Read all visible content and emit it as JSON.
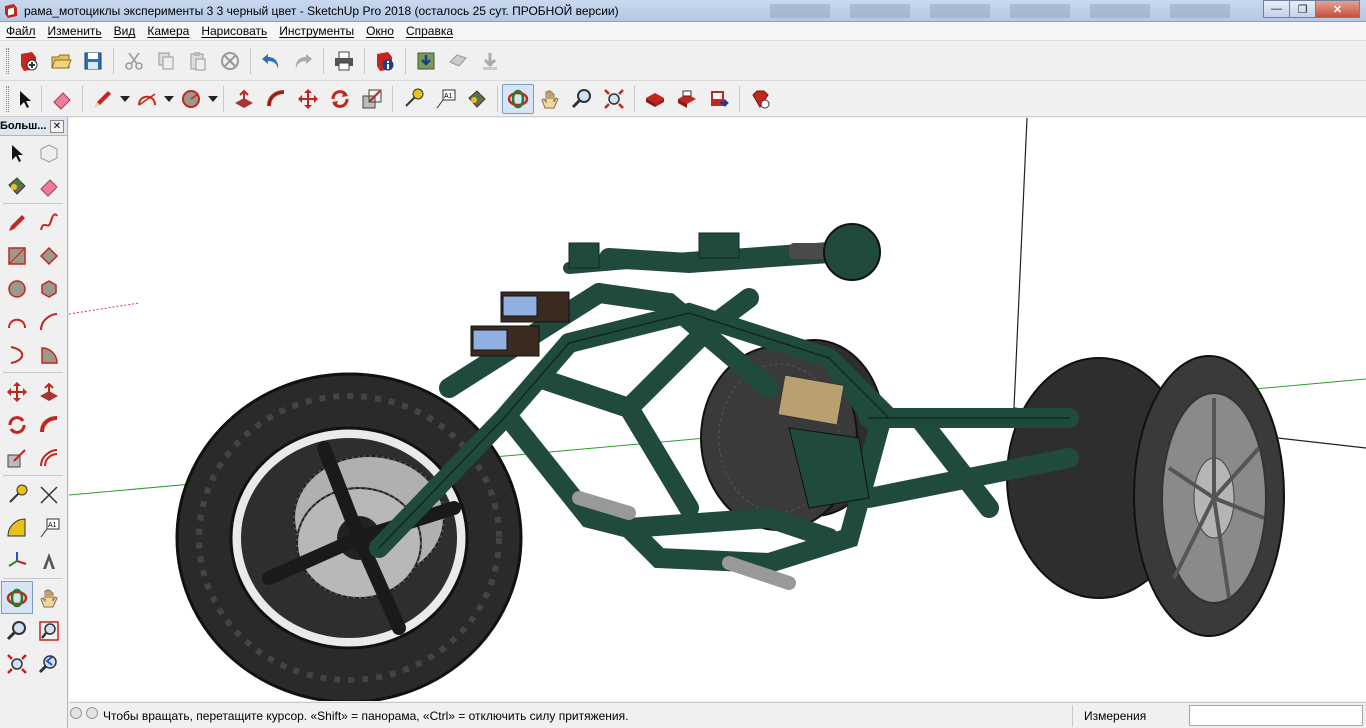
{
  "window": {
    "title": "рама_мотоциклы эксперименты 3 3  черный цвет - SketchUp Pro 2018 (осталось 25 сут. ПРОБНОЙ версии)",
    "minimize_glyph": "—",
    "maximize_glyph": "❐",
    "close_glyph": "✕"
  },
  "menu": {
    "items": [
      {
        "label": "Файл"
      },
      {
        "label": "Изменить"
      },
      {
        "label": "Вид"
      },
      {
        "label": "Камера"
      },
      {
        "label": "Нарисовать"
      },
      {
        "label": "Инструменты"
      },
      {
        "label": "Окно"
      },
      {
        "label": "Справка"
      }
    ]
  },
  "toolbar1": {
    "buttons": [
      "new-file-icon",
      "open-folder-icon",
      "save-icon",
      "cut-icon",
      "copy-icon",
      "paste-icon",
      "erase-selection-icon",
      "undo-icon",
      "redo-icon",
      "print-icon",
      "model-info-icon",
      "warehouse-get-icon",
      "warehouse-share-icon",
      "extension-warehouse-icon"
    ]
  },
  "toolbar2": {
    "buttons": [
      "select-arrow-icon",
      "eraser-icon",
      "pencil-line-icon",
      "arc-icon",
      "circle-icon",
      "push-pull-icon",
      "follow-me-icon",
      "move-icon",
      "rotate-icon",
      "scale-icon",
      "tape-measure-icon",
      "text-label-icon",
      "paint-bucket-icon",
      "orbit-icon",
      "pan-hand-icon",
      "zoom-icon",
      "zoom-extents-icon",
      "warehouse-icon",
      "extension-icon",
      "share-component-icon",
      "ruby-console-icon"
    ]
  },
  "palette": {
    "title": "Больш...",
    "close_glyph": "✕"
  },
  "status": {
    "hint": "Чтобы вращать, перетащите курсор. «Shift» = панорама, «Ctrl» = отключить силу притяжения.",
    "measure_label": "Измерения",
    "measure_value": ""
  },
  "colors": {
    "frame_green": "#1f4a3c",
    "tire_dark": "#2a2a2a",
    "axis_green": "#2aa02a",
    "axis_red": "#d33",
    "accent_red": "#c4251c"
  }
}
